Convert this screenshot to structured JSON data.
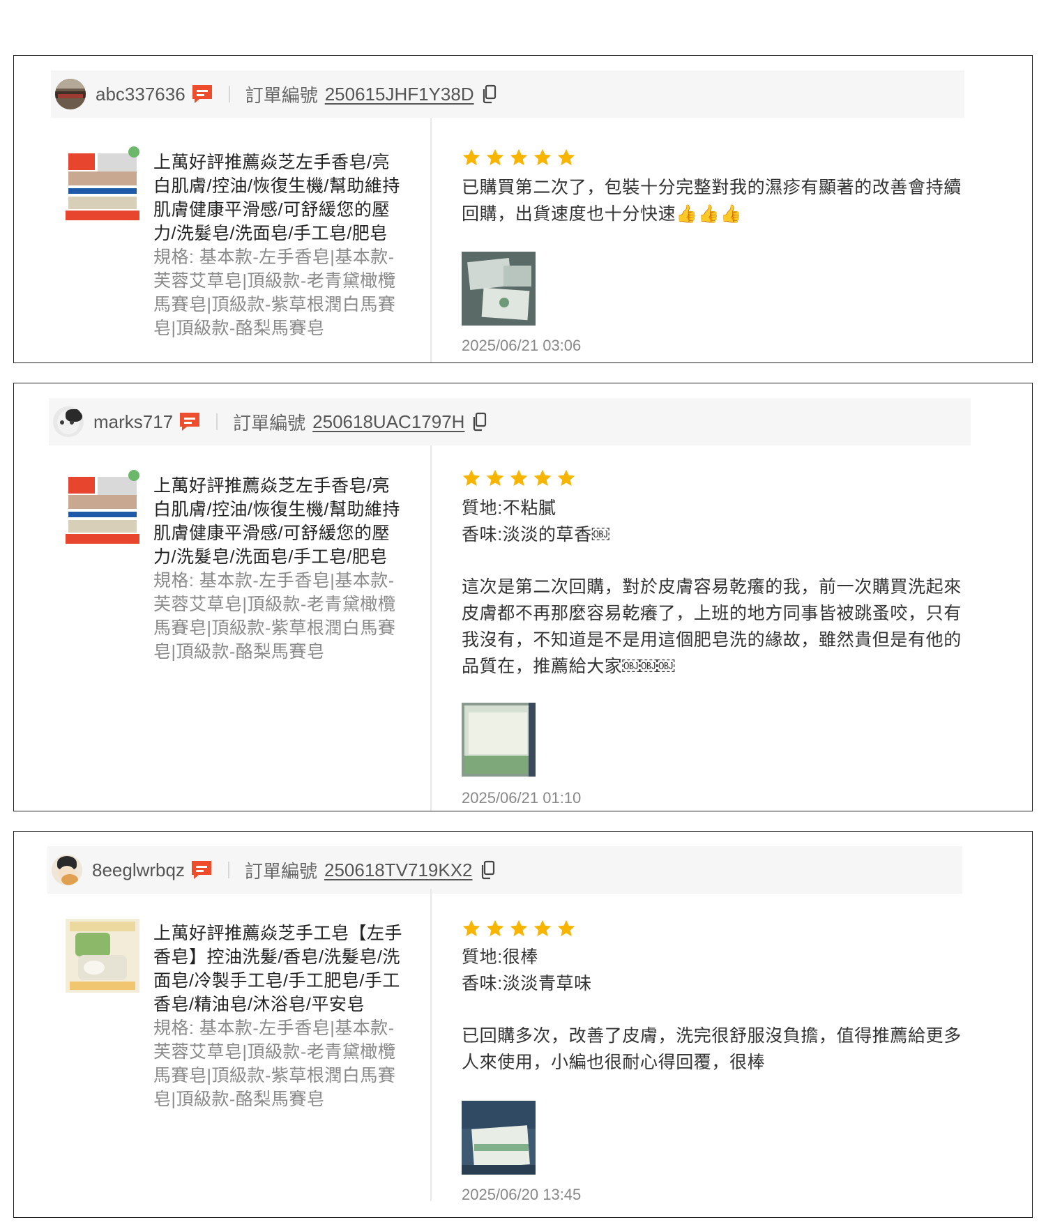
{
  "reviews": [
    {
      "username": "abc337636",
      "order_label": "訂單編號",
      "order_no": "250615JHF1Y38D",
      "product_name": "上萬好評推薦焱芝左手香皂/亮白肌膚/控油/恢復生機/幫助維持肌膚健康平滑感/可舒緩您的壓力/洗髮皂/洗面皂/手工皂/肥皂",
      "product_spec": "規格: 基本款-左手香皂|基本款-芙蓉艾草皂|頂級款-老青黛橄欖馬賽皂|頂級款-紫草根潤白馬賽皂|頂級款-酪梨馬賽皂",
      "rating": 5,
      "text_lines": [
        "已購買第二次了，包裝十分完整對我的濕疹有顯著的改善會持續回購，出貨速度也十分快速👍👍👍"
      ],
      "time": "2025/06/21 03:06"
    },
    {
      "username": "marks717",
      "order_label": "訂單編號",
      "order_no": "250618UAC1797H",
      "product_name": "上萬好評推薦焱芝左手香皂/亮白肌膚/控油/恢復生機/幫助維持肌膚健康平滑感/可舒緩您的壓力/洗髮皂/洗面皂/手工皂/肥皂",
      "product_spec": "規格: 基本款-左手香皂|基本款-芙蓉艾草皂|頂級款-老青黛橄欖馬賽皂|頂級款-紫草根潤白馬賽皂|頂級款-酪梨馬賽皂",
      "rating": 5,
      "texture": "質地:不粘膩",
      "scent": "香味:淡淡的草香￼",
      "body": "這次是第二次回購，對於皮膚容易乾癢的我，前一次購買洗起來皮膚都不再那麼容易乾癢了，上班的地方同事皆被跳蚤咬，只有我沒有，不知道是不是用這個肥皂洗的緣故，雖然貴但是有他的品質在，推薦給大家￼￼￼",
      "time": "2025/06/21 01:10"
    },
    {
      "username": "8eeglwrbqz",
      "order_label": "訂單編號",
      "order_no": "250618TV719KX2",
      "product_name": "上萬好評推薦焱芝手工皂【左手香皂】控油洗髮/香皂/洗髮皂/洗面皂/冷製手工皂/手工肥皂/手工香皂/精油皂/沐浴皂/平安皂",
      "product_spec": "規格: 基本款-左手香皂|基本款-芙蓉艾草皂|頂級款-老青黛橄欖馬賽皂|頂級款-紫草根潤白馬賽皂|頂級款-酪梨馬賽皂",
      "rating": 5,
      "texture": "質地:很棒",
      "scent": "香味:淡淡青草味",
      "body": "已回購多次，改善了皮膚，洗完很舒服沒負擔，值得推薦給更多人來使用，小編也很耐心得回覆，很棒",
      "time": "2025/06/20 13:45"
    }
  ],
  "colors": {
    "star": "#f7b500",
    "chat_icon": "#ee4d2d",
    "header_bg": "#f6f6f6"
  },
  "icons": {
    "chat": "chat-bubble-icon",
    "copy": "copy-icon",
    "star": "star-icon"
  }
}
